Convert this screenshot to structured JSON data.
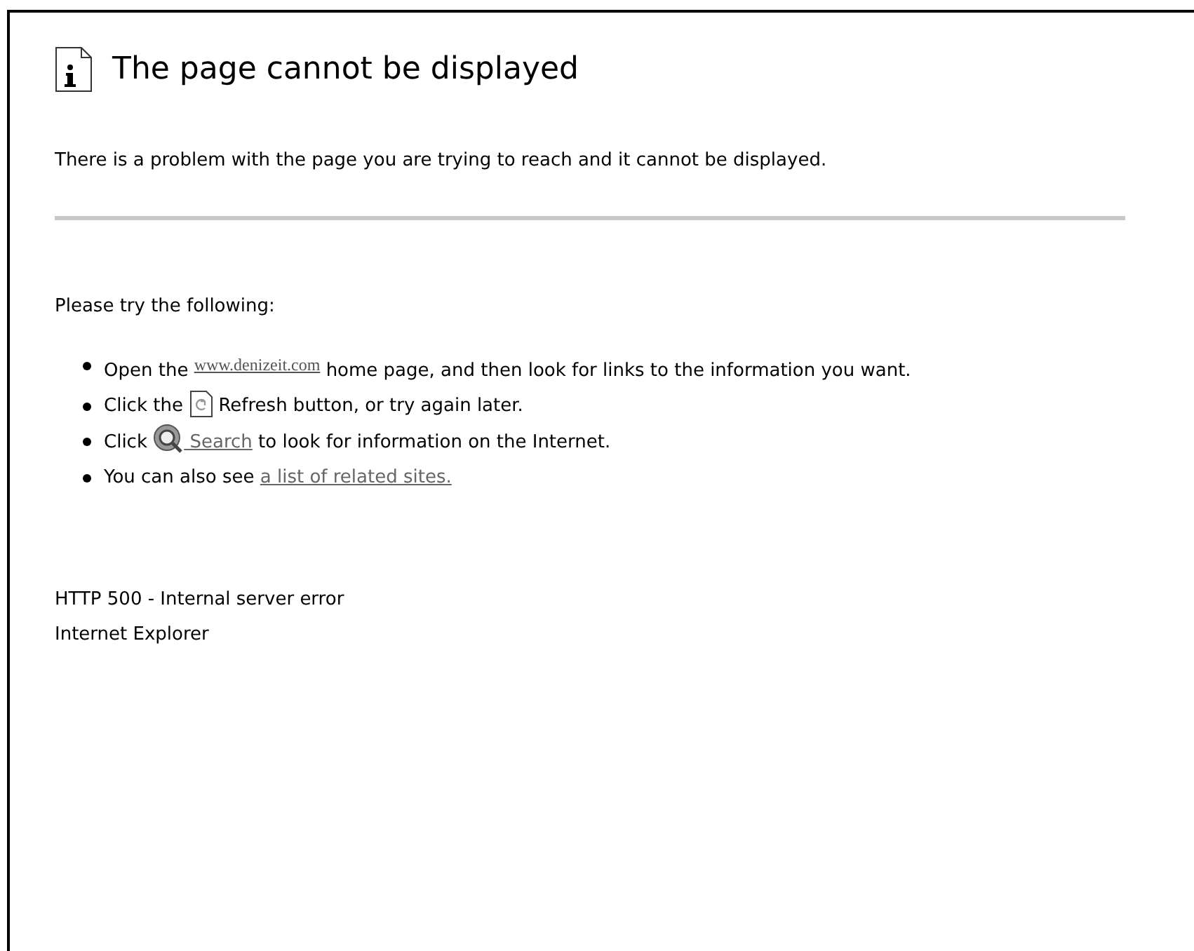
{
  "title": "The page cannot be displayed",
  "message": "There is a problem with the page you are trying to reach and it cannot be displayed.",
  "suggestions_heading": "Please try the following:",
  "suggestions": [
    [
      {
        "kind": "text",
        "text": "Open the "
      },
      {
        "kind": "site_link",
        "text": "www.denizeit.com"
      },
      {
        "kind": "text",
        "text": "  home page, and then look for links to the information you want."
      }
    ],
    [
      {
        "kind": "text",
        "text": "Click the "
      },
      {
        "kind": "refresh_icon"
      },
      {
        "kind": "text",
        "text": " Refresh button, or try again later."
      }
    ],
    [
      {
        "kind": "text",
        "text": "Click "
      },
      {
        "kind": "search_icon"
      },
      {
        "kind": "link",
        "text": " Search"
      },
      {
        "kind": "text",
        "text": " to look for information on the Internet."
      }
    ],
    [
      {
        "kind": "text",
        "text": "You can also see "
      },
      {
        "kind": "link",
        "text": "a list of related sites."
      }
    ]
  ],
  "footer": [
    "HTTP 500 - Internal server error",
    "Internet Explorer"
  ]
}
